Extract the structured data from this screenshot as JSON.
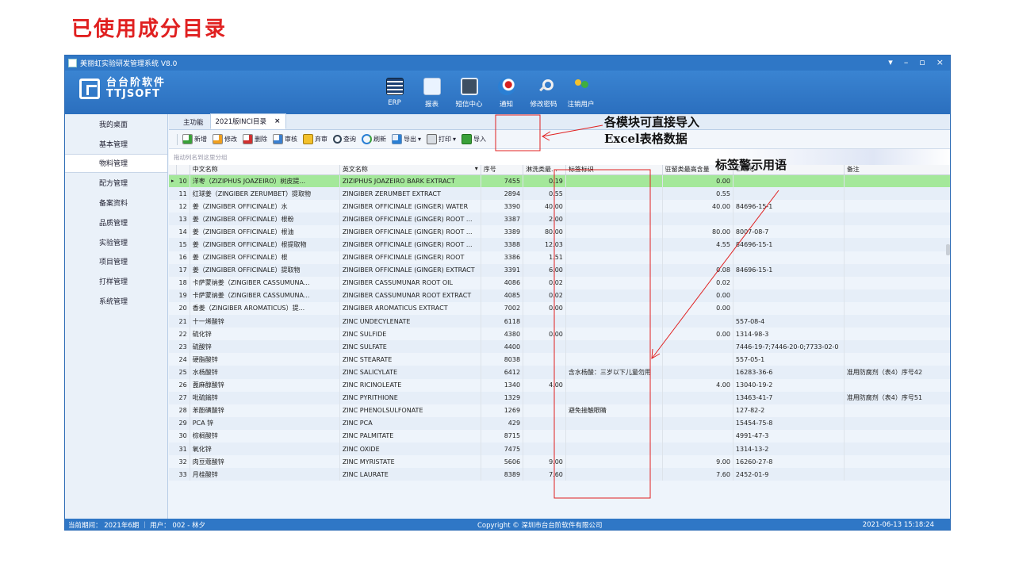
{
  "slide_title": "已使用成分目录",
  "window": {
    "title": "美丽虹实验研发管理系统 V8.0",
    "controls": [
      "▾",
      "–",
      "▫",
      "×"
    ]
  },
  "logo": {
    "cn": "台台阶软件",
    "en": "TTJSOFT"
  },
  "topnav": [
    {
      "label": "ERP",
      "icon": "erp-icon"
    },
    {
      "label": "报表",
      "icon": "report-icon"
    },
    {
      "label": "短信中心",
      "icon": "sms-icon"
    },
    {
      "label": "通知",
      "icon": "notify-icon"
    },
    {
      "label": "修改密码",
      "icon": "key-icon"
    },
    {
      "label": "注销用户",
      "icon": "users-icon"
    }
  ],
  "sidebar": [
    {
      "label": "我的桌面"
    },
    {
      "label": "基本管理"
    },
    {
      "label": "物料管理",
      "active": true
    },
    {
      "label": "配方管理"
    },
    {
      "label": "备案资料"
    },
    {
      "label": "品质管理"
    },
    {
      "label": "实验管理"
    },
    {
      "label": "项目管理"
    },
    {
      "label": "打样管理"
    },
    {
      "label": "系统管理"
    }
  ],
  "tabs": [
    {
      "label": "主功能",
      "active": false
    },
    {
      "label": "2021版INCI目录",
      "active": true,
      "close": "×"
    }
  ],
  "toolbar": {
    "new": "新增",
    "edit": "修改",
    "delete": "删除",
    "audit": "审核",
    "abandon": "弃审",
    "query": "查询",
    "refresh": "刷新",
    "export": "导出",
    "print": "打印",
    "import": "导入",
    "dropdown": "▾"
  },
  "group_hint": "拖动列名到这里分组",
  "table": {
    "columns": [
      "中文名称",
      "英文名称",
      "序号",
      "淋洗类最...",
      "标签标识",
      "驻留类最高含量",
      "CAS号",
      "备注"
    ],
    "sort_glyph": "▾",
    "selected_marker": "▸",
    "rows": [
      [
        "10",
        "洋枣（ZIZIPHUS JOAZEIRO）树皮提...",
        "ZIZIPHUS JOAZEIRO BARK EXTRACT",
        "7455",
        "0.19",
        "",
        "0.00",
        "",
        ""
      ],
      [
        "11",
        "红球姜（ZINGIBER ZERUMBET）提取物",
        "ZINGIBER ZERUMBET EXTRACT",
        "2894",
        "0.55",
        "",
        "0.55",
        "",
        ""
      ],
      [
        "12",
        "姜（ZINGIBER OFFICINALE）水",
        "ZINGIBER OFFICINALE (GINGER) WATER",
        "3390",
        "40.00",
        "",
        "40.00",
        "84696-15-1",
        ""
      ],
      [
        "13",
        "姜（ZINGIBER OFFICINALE）根粉",
        "ZINGIBER OFFICINALE (GINGER) ROOT ...",
        "3387",
        "2.00",
        "",
        "",
        "",
        ""
      ],
      [
        "14",
        "姜（ZINGIBER OFFICINALE）根油",
        "ZINGIBER OFFICINALE (GINGER) ROOT ...",
        "3389",
        "80.00",
        "",
        "80.00",
        "8007-08-7",
        ""
      ],
      [
        "15",
        "姜（ZINGIBER OFFICINALE）根提取物",
        "ZINGIBER OFFICINALE (GINGER) ROOT ...",
        "3388",
        "12.03",
        "",
        "4.55",
        "84696-15-1",
        ""
      ],
      [
        "16",
        "姜（ZINGIBER OFFICINALE）根",
        "ZINGIBER OFFICINALE (GINGER) ROOT",
        "3386",
        "1.51",
        "",
        "",
        "",
        ""
      ],
      [
        "17",
        "姜（ZINGIBER OFFICINALE）提取物",
        "ZINGIBER OFFICINALE (GINGER) EXTRACT",
        "3391",
        "6.00",
        "",
        "0.08",
        "84696-15-1",
        ""
      ],
      [
        "18",
        "卡萨蒙纳姜（ZINGIBER CASSUMUNA...",
        "ZINGIBER CASSUMUNAR ROOT OIL",
        "4086",
        "0.02",
        "",
        "0.02",
        "",
        ""
      ],
      [
        "19",
        "卡萨蒙纳姜（ZINGIBER CASSUMUNA...",
        "ZINGIBER CASSUMUNAR ROOT EXTRACT",
        "4085",
        "0.02",
        "",
        "0.00",
        "",
        ""
      ],
      [
        "20",
        "香姜（ZINGIBER AROMATICUS）提...",
        "ZINGIBER AROMATICUS EXTRACT",
        "7002",
        "0.00",
        "",
        "0.00",
        "",
        ""
      ],
      [
        "21",
        "十一烯酸锌",
        "ZINC UNDECYLENATE",
        "6118",
        "",
        "",
        "",
        "557-08-4",
        ""
      ],
      [
        "22",
        "硫化锌",
        "ZINC SULFIDE",
        "4380",
        "0.00",
        "",
        "0.00",
        "1314-98-3",
        ""
      ],
      [
        "23",
        "硫酸锌",
        "ZINC SULFATE",
        "4400",
        "",
        "",
        "",
        "7446-19-7;7446-20-0;7733-02-0",
        ""
      ],
      [
        "24",
        "硬脂酸锌",
        "ZINC STEARATE",
        "8038",
        "",
        "",
        "",
        "557-05-1",
        ""
      ],
      [
        "25",
        "水杨酸锌",
        "ZINC SALICYLATE",
        "6412",
        "",
        "含水杨酸：三岁以下儿童勿用",
        "",
        "16283-36-6",
        "准用防腐剂（表4）序号42"
      ],
      [
        "26",
        "蓖麻醇酸锌",
        "ZINC RICINOLEATE",
        "1340",
        "4.00",
        "",
        "4.00",
        "13040-19-2",
        ""
      ],
      [
        "27",
        "吡硫鎓锌",
        "ZINC PYRITHIONE",
        "1329",
        "",
        "",
        "",
        "13463-41-7",
        "准用防腐剂（表4）序号51"
      ],
      [
        "28",
        "苯酚磺酸锌",
        "ZINC PHENOLSULFONATE",
        "1269",
        "",
        "避免接触眼睛",
        "",
        "127-82-2",
        ""
      ],
      [
        "29",
        "PCA 锌",
        "ZINC PCA",
        "429",
        "",
        "",
        "",
        "15454-75-8",
        ""
      ],
      [
        "30",
        "棕榈酸锌",
        "ZINC PALMITATE",
        "8715",
        "",
        "",
        "",
        "4991-47-3",
        ""
      ],
      [
        "31",
        "氧化锌",
        "ZINC OXIDE",
        "7475",
        "",
        "",
        "",
        "1314-13-2",
        ""
      ],
      [
        "32",
        "肉豆蔻酸锌",
        "ZINC MYRISTATE",
        "5606",
        "9.00",
        "",
        "9.00",
        "16260-27-8",
        ""
      ],
      [
        "33",
        "月桂酸锌",
        "ZINC LAURATE",
        "8389",
        "7.60",
        "",
        "7.60",
        "2452-01-9",
        ""
      ]
    ]
  },
  "status": {
    "period": "当前期间： 2021年6期 ｜ 用户： 002 - 林夕",
    "copyright": "Copyright © 深圳市台台阶软件有限公司",
    "datetime": "2021-06-13 15:18:24"
  },
  "annotations": {
    "import_note_line1": "各模块可直接导入",
    "import_note_line2": "Excel表格数据",
    "label_note": "标签警示用语"
  },
  "colors": {
    "accent_blue": "#2f77c6",
    "selected_row": "#a4e89a",
    "annotation_red": "#e02020"
  }
}
